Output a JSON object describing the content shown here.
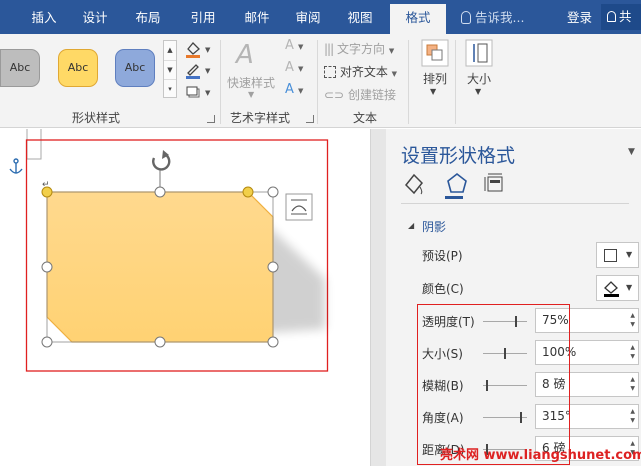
{
  "tabs": [
    {
      "label": "插入"
    },
    {
      "label": "设计"
    },
    {
      "label": "布局"
    },
    {
      "label": "引用"
    },
    {
      "label": "邮件"
    },
    {
      "label": "审阅"
    },
    {
      "label": "视图"
    },
    {
      "label": "格式",
      "active": true
    }
  ],
  "tell_me": "告诉我...",
  "login": "登录",
  "share": "共",
  "ribbon": {
    "shape_styles": {
      "label": "形状样式",
      "swatches": [
        {
          "text": "Abc",
          "fill": "#bdbdbd",
          "border": "#9a9a9a"
        },
        {
          "text": "Abc",
          "fill": "#ffd966",
          "border": "#e0a833"
        },
        {
          "text": "Abc",
          "fill": "#8ea9db",
          "border": "#5f7fbf"
        }
      ]
    },
    "wordart": {
      "label": "艺术字样式",
      "quick_styles": "快速样式"
    },
    "text": {
      "label": "文本",
      "direction": "文字方向",
      "align": "对齐文本",
      "link": "创建链接"
    },
    "arrange": {
      "label": "排列"
    },
    "size": {
      "label": "大小"
    }
  },
  "pane": {
    "title": "设置形状格式",
    "section": "阴影",
    "preset": "预设(P)",
    "color": "颜色(C)",
    "rows": [
      {
        "label": "透明度(T)",
        "value": "75%",
        "slider": 0.75
      },
      {
        "label": "大小(S)",
        "value": "100%",
        "slider": 0.5
      },
      {
        "label": "模糊(B)",
        "value": "8 磅",
        "slider": 0.08
      },
      {
        "label": "角度(A)",
        "value": "315°",
        "slider": 0.875
      },
      {
        "label": "距离(D)",
        "value": "6 磅",
        "slider": 0.06
      }
    ]
  },
  "watermark": "亮术网 www.liangshunet.com",
  "colors": {
    "brand": "#2b579a",
    "shape_fill": "#ffd27f",
    "highlight": "#e02020"
  }
}
